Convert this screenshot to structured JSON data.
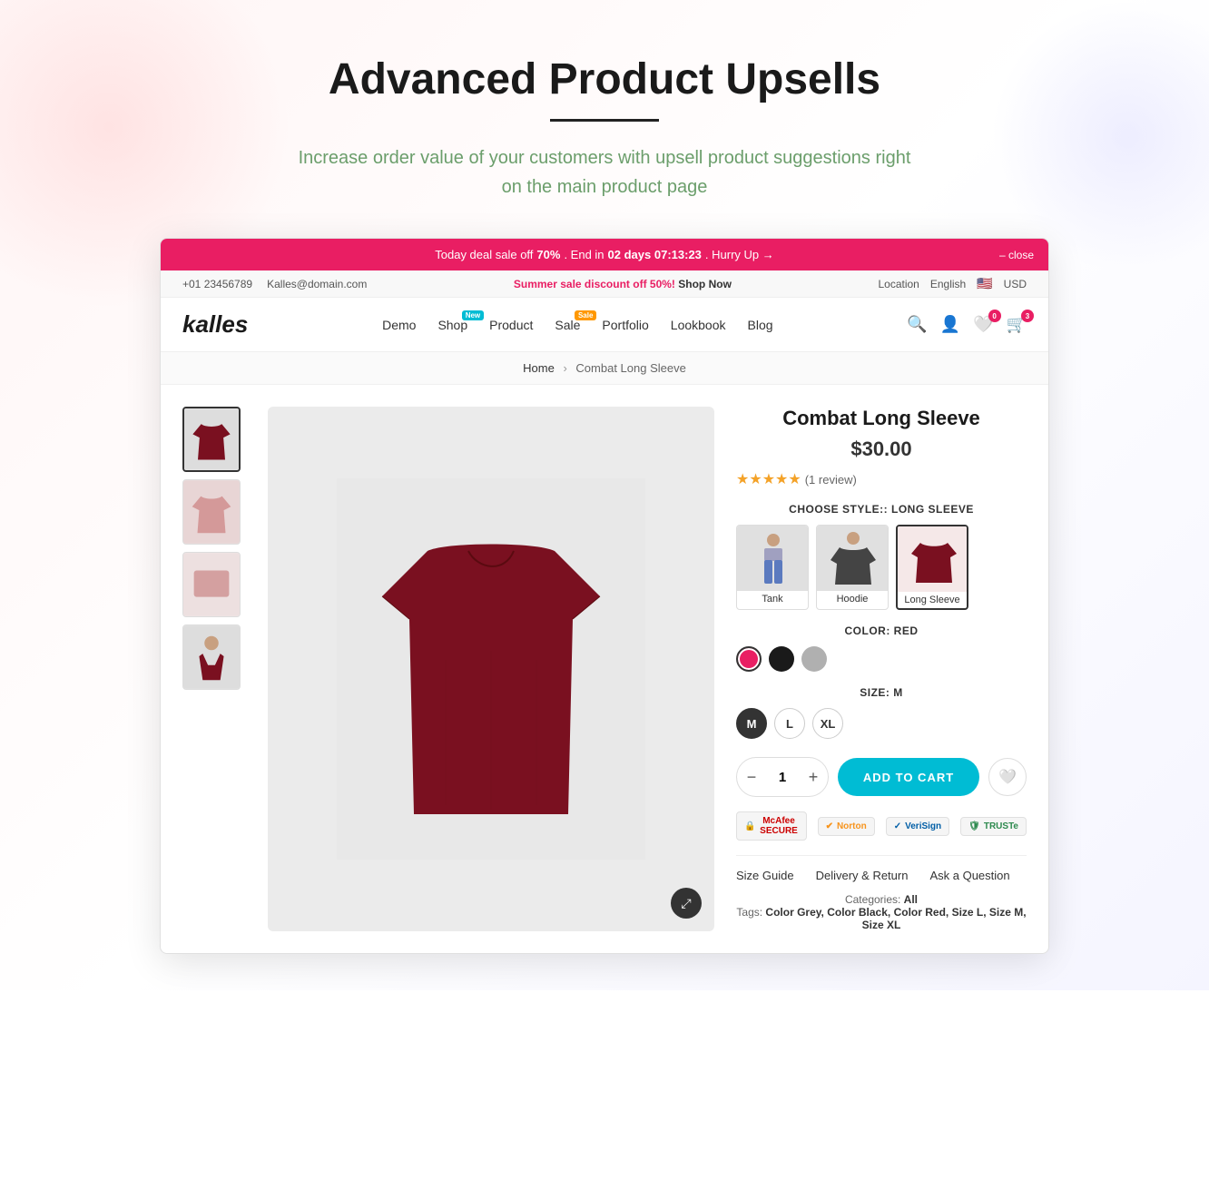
{
  "hero": {
    "title": "Advanced Product Upsells",
    "subtitle": "Increase order value of your customers with upsell product suggestions right on the main product page"
  },
  "promo_bar": {
    "text_start": "Today deal sale off ",
    "discount": "70%",
    "text_mid": ". End in ",
    "countdown": "02 days 07:13:23",
    "text_end": ". Hurry Up →",
    "close": "– close"
  },
  "top_bar": {
    "phone": "+01 23456789",
    "email": "Kalles@domain.com",
    "promo": "Summer sale discount off ",
    "promo_discount": "50%!",
    "promo_link": "Shop Now",
    "location": "Location",
    "language": "English",
    "currency": "USD"
  },
  "nav": {
    "logo": "kalles",
    "links": [
      {
        "label": "Demo",
        "badge": null
      },
      {
        "label": "Shop",
        "badge": "New"
      },
      {
        "label": "Product",
        "badge": null
      },
      {
        "label": "Sale",
        "badge": "Sale"
      },
      {
        "label": "Portfolio",
        "badge": null
      },
      {
        "label": "Lookbook",
        "badge": null
      },
      {
        "label": "Blog",
        "badge": null
      }
    ],
    "wishlist_count": "0",
    "cart_count": "3"
  },
  "breadcrumb": {
    "home": "Home",
    "current": "Combat Long Sleeve"
  },
  "product": {
    "title": "Combat Long Sleeve",
    "price": "$30.00",
    "stars": 5,
    "reviews": "1 review",
    "style_label": "CHOOSE STYLE:: LONG SLEEVE",
    "styles": [
      {
        "name": "Tank"
      },
      {
        "name": "Hoodie"
      },
      {
        "name": "Long Sleeve",
        "active": true
      }
    ],
    "color_label": "COLOR: RED",
    "colors": [
      {
        "name": "red",
        "active": true
      },
      {
        "name": "black"
      },
      {
        "name": "gray"
      }
    ],
    "size_label": "SIZE: M",
    "sizes": [
      {
        "label": "M",
        "active": true
      },
      {
        "label": "L"
      },
      {
        "label": "XL"
      }
    ],
    "quantity": "1",
    "add_to_cart": "ADD TO CART",
    "trust_badges": [
      {
        "name": "McAfee SECURE",
        "icon": "🔒"
      },
      {
        "name": "Norton",
        "icon": "✔"
      },
      {
        "name": "VeriSign",
        "icon": "✓"
      },
      {
        "name": "TRUSTe",
        "icon": "🛡"
      }
    ],
    "tabs": [
      "Size Guide",
      "Delivery & Return",
      "Ask a Question"
    ],
    "categories": "All",
    "tags": "Color Grey, Color Black, Color Red, Size L, Size M, Size XL"
  }
}
